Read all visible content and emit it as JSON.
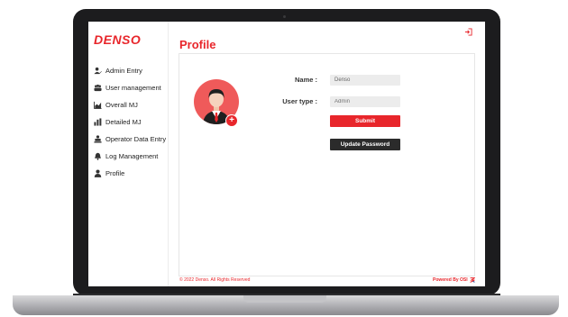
{
  "brand": "DENSO",
  "sidebar": {
    "items": [
      {
        "label": "Admin Entry",
        "icon": "user-edit-icon"
      },
      {
        "label": "User management",
        "icon": "users-icon"
      },
      {
        "label": "Overall MJ",
        "icon": "chart-area-icon"
      },
      {
        "label": "Detailed MJ",
        "icon": "bar-chart-icon"
      },
      {
        "label": "Operator Data Entry",
        "icon": "operator-icon"
      },
      {
        "label": "Log Management",
        "icon": "bell-icon"
      },
      {
        "label": "Profile",
        "icon": "user-icon"
      }
    ]
  },
  "page": {
    "title": "Profile"
  },
  "profile": {
    "name_label": "Name :",
    "name_value": "Denso",
    "user_type_label": "User type :",
    "user_type_placeholder": "Admin",
    "submit_label": "Submit",
    "update_password_label": "Update Password"
  },
  "footer": {
    "copyright": "© 2022 Denso. All Rights Reserved",
    "powered_by": "Powered By OSI"
  },
  "colors": {
    "accent": "#e8262b",
    "dark_button": "#2b2b2b"
  }
}
